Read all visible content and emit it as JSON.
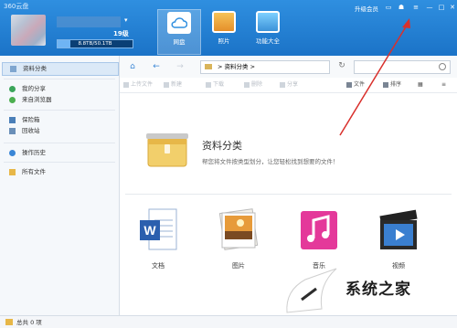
{
  "app": {
    "title": "360云盘"
  },
  "header": {
    "level": "19级",
    "username_caret": "▾",
    "storage": {
      "text": "8.8TB/50.1TB",
      "used_fraction": 0.176
    },
    "tabs": [
      {
        "label": "网盘",
        "icon": "cloud-icon"
      },
      {
        "label": "照片",
        "icon": "photos-icon"
      },
      {
        "label": "功能大全",
        "icon": "apps-icon"
      }
    ],
    "upgrade_label": "升级会员",
    "controls": {
      "skin": "▭",
      "shirt": "☗",
      "menu": "≡",
      "min": "—",
      "max": "□",
      "close": "✕"
    }
  },
  "sidebar": {
    "items": [
      {
        "label": "资料分类",
        "icon": "category-icon"
      },
      {
        "label": "我的分享",
        "icon": "share-icon"
      },
      {
        "label": "来自浏览器",
        "icon": "browser-icon"
      },
      {
        "label": "保险箱",
        "icon": "safebox-icon"
      },
      {
        "label": "回收站",
        "icon": "trash-icon"
      },
      {
        "label": "操作历史",
        "icon": "history-icon"
      },
      {
        "label": "所有文件",
        "icon": "folder-icon"
      }
    ]
  },
  "nav": {
    "home": "⌂",
    "back": "←",
    "forward": "→",
    "crumb_sep": ">",
    "crumb": "资料分类",
    "crumb_tail": ">",
    "refresh": "↻"
  },
  "actions": {
    "upload": "上传文件",
    "new": "新建",
    "download": "下载",
    "delete": "删除",
    "share": "分享",
    "file": "文件",
    "sort": "排序",
    "view": "▦",
    "list": "≡"
  },
  "content": {
    "title": "资料分类",
    "description": "帮您将文件按类型划分，让您轻松找到想要的文件！",
    "categories": [
      {
        "label": "文档",
        "icon": "document-icon"
      },
      {
        "label": "图片",
        "icon": "picture-icon"
      },
      {
        "label": "音乐",
        "icon": "music-icon"
      },
      {
        "label": "视频",
        "icon": "video-icon"
      }
    ]
  },
  "status": {
    "text": "总共 0 项"
  },
  "watermark": {
    "text": "系统之家"
  },
  "colors": {
    "header": "#2f8fe0",
    "annotation_arrow": "#d9302c",
    "folder": "#e7b748"
  }
}
